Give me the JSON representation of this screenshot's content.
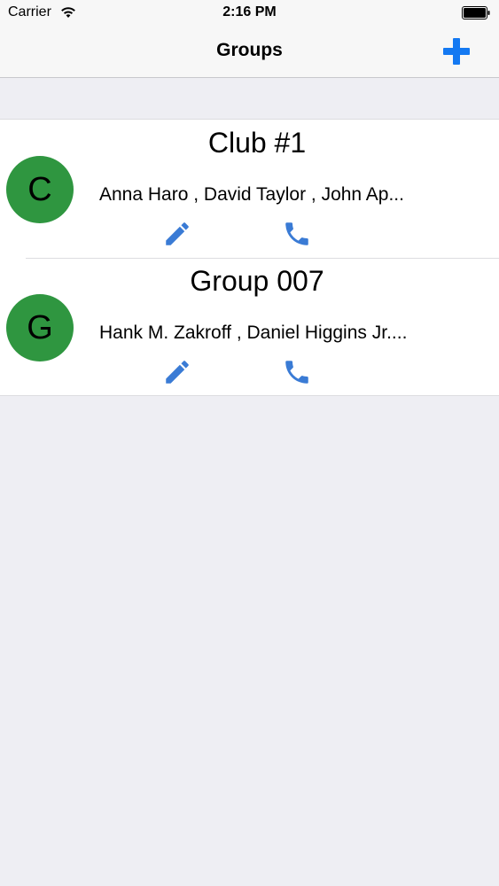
{
  "status_bar": {
    "carrier": "Carrier",
    "time": "2:16 PM"
  },
  "nav": {
    "title": "Groups",
    "add_icon": "plus-icon"
  },
  "colors": {
    "accent": "#1479f2",
    "avatar": "#2f9640",
    "action_icon": "#3a7bd5"
  },
  "groups": [
    {
      "initial": "C",
      "name": "Club #1",
      "members": "Anna Haro , David Taylor , John Ap..."
    },
    {
      "initial": "G",
      "name": "Group 007",
      "members": "Hank M. Zakroff , Daniel Higgins Jr...."
    }
  ]
}
